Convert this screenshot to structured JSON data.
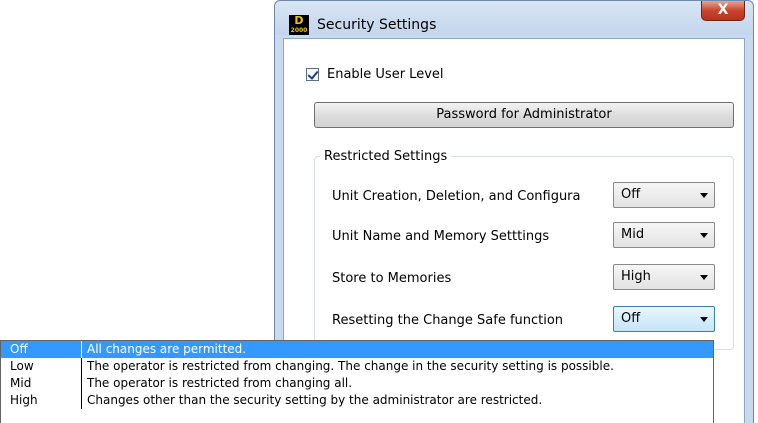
{
  "window": {
    "title": "Security Settings",
    "close_label": "X",
    "app_icon_text": "2000"
  },
  "enable_user_level": {
    "label": "Enable User Level",
    "checked": true
  },
  "password_button": {
    "label": "Password for Administrator"
  },
  "restricted_settings": {
    "title": "Restricted Settings",
    "rows": [
      {
        "label": "Unit Creation, Deletion, and Configura",
        "value": "Off"
      },
      {
        "label": "Unit Name and Memory Setttings",
        "value": "Mid"
      },
      {
        "label": "Store to Memories",
        "value": "High"
      },
      {
        "label": "Resetting the Change Safe function",
        "value": "Off"
      }
    ]
  },
  "dropdown": {
    "selected": "Off",
    "options": [
      {
        "key": "Off",
        "desc": "All changes are permitted."
      },
      {
        "key": "Low",
        "desc": "The operator is restricted from changing. The change in the security setting is possible."
      },
      {
        "key": "Mid",
        "desc": "The operator is restricted from changing all."
      },
      {
        "key": "High",
        "desc": "Changes other than the security setting by the administrator are restricted."
      }
    ]
  },
  "colors": {
    "selection": "#3399ff",
    "title_bar": "#c9d9ee",
    "close_button": "#c8452e"
  }
}
